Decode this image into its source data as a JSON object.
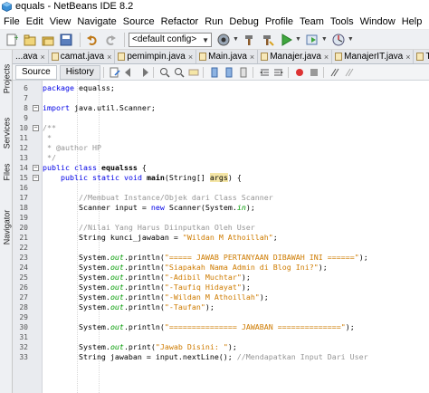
{
  "window": {
    "title": "equals - NetBeans IDE 8.2"
  },
  "menubar": {
    "items": [
      "File",
      "Edit",
      "View",
      "Navigate",
      "Source",
      "Refactor",
      "Run",
      "Debug",
      "Profile",
      "Team",
      "Tools",
      "Window",
      "Help"
    ]
  },
  "toolbar": {
    "config": "<default config>"
  },
  "sidebar": {
    "tabs": [
      "Projects",
      "Services",
      "Files",
      "Navigator"
    ]
  },
  "tabs": [
    {
      "label": "...ava",
      "active": false
    },
    {
      "label": "camat.java",
      "active": false
    },
    {
      "label": "pemimpin.java",
      "active": false
    },
    {
      "label": "Main.java",
      "active": false
    },
    {
      "label": "Manajer.java",
      "active": false
    },
    {
      "label": "ManajerIT.java",
      "active": false
    },
    {
      "label": "Tumbuhan.java",
      "active": false
    }
  ],
  "editor_toolbar": {
    "source_label": "Source",
    "history_label": "History"
  },
  "code": {
    "lines": [
      {
        "num": "6",
        "text": "package equalss;"
      },
      {
        "num": "7",
        "text": ""
      },
      {
        "num": "8",
        "text": "import java.util.Scanner;"
      },
      {
        "num": "9",
        "text": ""
      },
      {
        "num": "10",
        "text": "/**"
      },
      {
        "num": "11",
        "text": " *"
      },
      {
        "num": "12",
        "text": " * @author HP"
      },
      {
        "num": "13",
        "text": " */"
      },
      {
        "num": "14",
        "text": "public class equalsss {"
      },
      {
        "num": "15",
        "text": "    public static void main(String[] args) {"
      },
      {
        "num": "16",
        "text": ""
      },
      {
        "num": "17",
        "text": "        //Membuat Instance/Objek dari Class Scanner"
      },
      {
        "num": "18",
        "text": "        Scanner input = new Scanner(System.in);"
      },
      {
        "num": "19",
        "text": ""
      },
      {
        "num": "20",
        "text": "        //Nilai Yang Harus Diinputkan Oleh User"
      },
      {
        "num": "21",
        "text": "        String kunci_jawaban = \"Wildan M Athoillah\";"
      },
      {
        "num": "22",
        "text": ""
      },
      {
        "num": "23",
        "text": "        System.out.println(\"===== JAWAB PERTANYAAN DIBAWAH INI ======\");"
      },
      {
        "num": "24",
        "text": "        System.out.println(\"Siapakah Nama Admin di Blog Ini?\");"
      },
      {
        "num": "25",
        "text": "        System.out.println(\"-Adibil Muchtar\");"
      },
      {
        "num": "26",
        "text": "        System.out.println(\"-Taufiq Hidayat\");"
      },
      {
        "num": "27",
        "text": "        System.out.println(\"-Wildan M Athoillah\");"
      },
      {
        "num": "28",
        "text": "        System.out.println(\"-Taufan\");"
      },
      {
        "num": "29",
        "text": ""
      },
      {
        "num": "30",
        "text": "        System.out.println(\"=============== JAWABAN ==============\");"
      },
      {
        "num": "31",
        "text": ""
      },
      {
        "num": "32",
        "text": "        System.out.print(\"Jawab Disini: \");"
      },
      {
        "num": "33",
        "text": "        String jawaban = input.nextLine(); //Mendapatkan Input Dari User"
      }
    ]
  },
  "colors": {
    "keyword": "#0000e6",
    "string": "#ce7b00",
    "comment": "#969696",
    "field": "#009900",
    "highlight": "#f5e6a6"
  }
}
